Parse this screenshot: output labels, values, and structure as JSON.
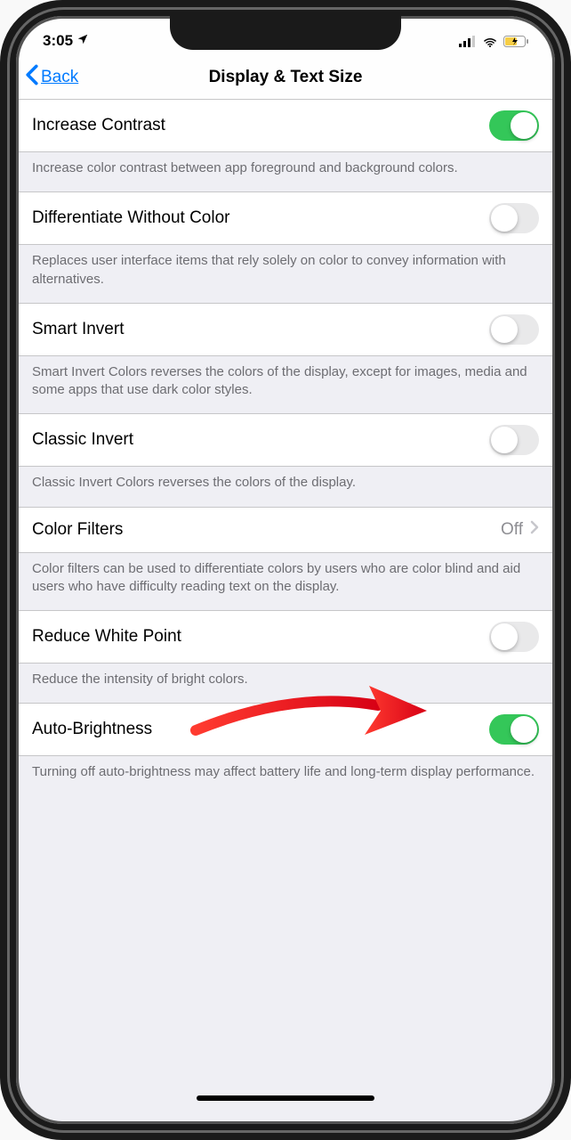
{
  "status": {
    "time": "3:05",
    "location_icon": "location-arrow"
  },
  "nav": {
    "back_label": "Back",
    "title": "Display & Text Size"
  },
  "rows": {
    "increase_contrast": {
      "label": "Increase Contrast",
      "footer": "Increase color contrast between app foreground and background colors.",
      "on": true
    },
    "differentiate": {
      "label": "Differentiate Without Color",
      "footer": "Replaces user interface items that rely solely on color to convey information with alternatives.",
      "on": false
    },
    "smart_invert": {
      "label": "Smart Invert",
      "footer": "Smart Invert Colors reverses the colors of the display, except for images, media and some apps that use dark color styles.",
      "on": false
    },
    "classic_invert": {
      "label": "Classic Invert",
      "footer": "Classic Invert Colors reverses the colors of the display.",
      "on": false
    },
    "color_filters": {
      "label": "Color Filters",
      "value": "Off",
      "footer": "Color filters can be used to differentiate colors by users who are color blind and aid users who have difficulty reading text on the display."
    },
    "reduce_white_point": {
      "label": "Reduce White Point",
      "footer": "Reduce the intensity of bright colors.",
      "on": false
    },
    "auto_brightness": {
      "label": "Auto-Brightness",
      "footer": "Turning off auto-brightness may affect battery life and long-term display performance.",
      "on": true
    }
  },
  "annotation": {
    "type": "arrow",
    "color": "#ff0000",
    "points_to": "color-filters-row"
  }
}
